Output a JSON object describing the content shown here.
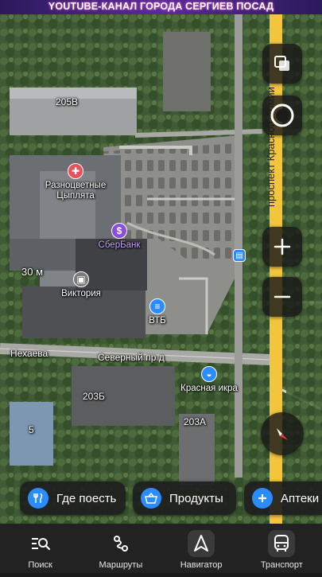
{
  "banner": {
    "text": "YOUTUBE-КАНАЛ ГОРОДА СЕРГИЕВ ПОСАД"
  },
  "map": {
    "labels": {
      "bldg_205v": "205В",
      "bldg_30m": "30 м",
      "street_nekhaeva": "Нехаева",
      "street_severny": "Северный пр д",
      "bldg_203b": "203Б",
      "bldg_5": "5",
      "bldg_203a": "203А",
      "prospect": "проспект Красной Армии"
    },
    "pois": {
      "raznotsvetnye": "Разноцветные Цыплята",
      "sberbank": "СберБанк",
      "viktoriya": "Виктория",
      "vtb": "ВТБ",
      "krasnaya_ikra": "Красная икра"
    }
  },
  "chips": [
    {
      "label": "Где поесть",
      "icon": "fork-knife-icon"
    },
    {
      "label": "Продукты",
      "icon": "basket-icon"
    },
    {
      "label": "Аптеки",
      "icon": "plus-icon"
    }
  ],
  "nav": [
    {
      "label": "Поиск",
      "icon": "search-list-icon"
    },
    {
      "label": "Маршруты",
      "icon": "route-icon"
    },
    {
      "label": "Навигатор",
      "icon": "navigator-arrow-icon"
    },
    {
      "label": "Транспорт",
      "icon": "bus-icon"
    }
  ],
  "colors": {
    "accent_blue": "#2b8cff",
    "poi_red": "#e8505b",
    "poi_purple": "#8a4fd8",
    "poi_gray": "#7a7a7a",
    "road_yellow": "#f2c53d",
    "compass_red": "#e23b3b"
  }
}
